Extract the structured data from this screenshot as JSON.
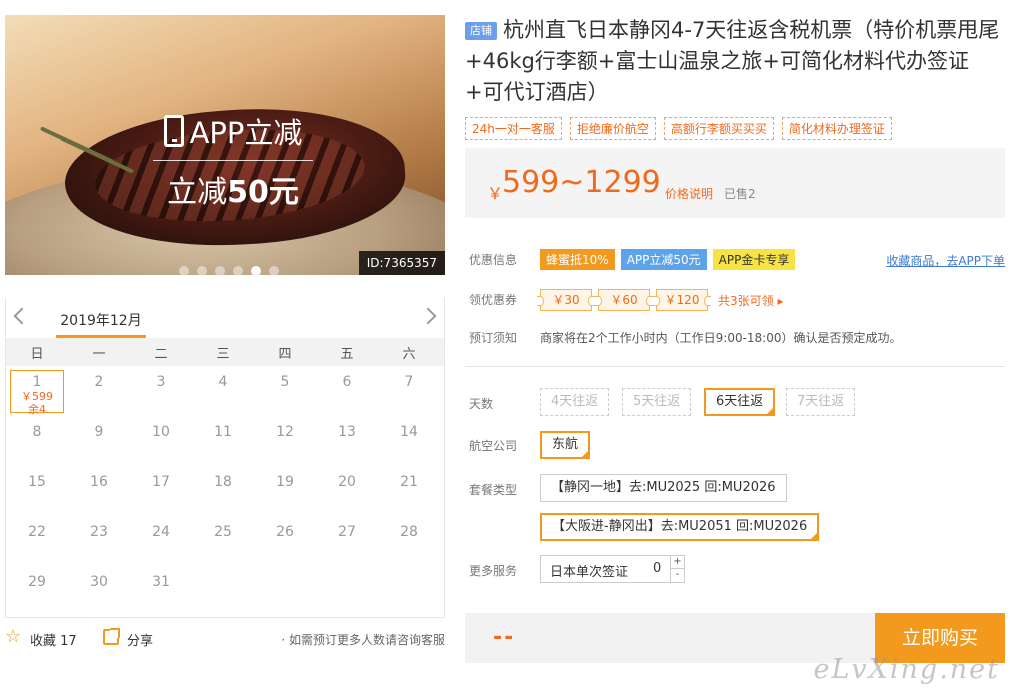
{
  "hero": {
    "promo_title": "APP立减",
    "promo_sub_prefix": "立减",
    "promo_sub_amount": "50元",
    "id_tag": "ID:7365357",
    "slide_count": 6,
    "active_slide": 5
  },
  "calendar": {
    "month": "2019年12月",
    "weekdays": [
      "日",
      "一",
      "二",
      "三",
      "四",
      "五",
      "六"
    ],
    "days": [
      {
        "day": "1",
        "price": "￥599",
        "stock": "余4",
        "selected": true
      },
      {
        "day": "2"
      },
      {
        "day": "3"
      },
      {
        "day": "4"
      },
      {
        "day": "5"
      },
      {
        "day": "6"
      },
      {
        "day": "7"
      },
      {
        "day": "8"
      },
      {
        "day": "9"
      },
      {
        "day": "10"
      },
      {
        "day": "11"
      },
      {
        "day": "12"
      },
      {
        "day": "13"
      },
      {
        "day": "14"
      },
      {
        "day": "15"
      },
      {
        "day": "16"
      },
      {
        "day": "17"
      },
      {
        "day": "18"
      },
      {
        "day": "19"
      },
      {
        "day": "20"
      },
      {
        "day": "21"
      },
      {
        "day": "22"
      },
      {
        "day": "23"
      },
      {
        "day": "24"
      },
      {
        "day": "25"
      },
      {
        "day": "26"
      },
      {
        "day": "27"
      },
      {
        "day": "28"
      },
      {
        "day": "29"
      },
      {
        "day": "30"
      },
      {
        "day": "31"
      }
    ]
  },
  "share_bar": {
    "favorite_label": "收藏",
    "favorite_count": "17",
    "share_label": "分享",
    "consult_text": "· 如需预订更多人数请咨询客服"
  },
  "product": {
    "shop_badge": "店铺",
    "title": "杭州直飞日本静冈4-7天往返含税机票（特价机票甩尾+46kg行李额+富士山温泉之旅+可简化材料代办签证+可代订酒店）",
    "tags": [
      "24h一对一客服",
      "拒绝廉价航空",
      "高额行李额买买买",
      "简化材料办理签证"
    ],
    "price_yen": "￥",
    "price": "599~1299",
    "price_note": "价格说明",
    "sold": "已售2"
  },
  "discounts": {
    "label": "优惠信息",
    "tags": [
      {
        "text": "蜂蜜抵10%",
        "style": "orange"
      },
      {
        "text": "APP立减50元",
        "style": "blue"
      },
      {
        "text": "APP金卡专享",
        "style": "yellow"
      }
    ],
    "app_link": "收藏商品，去APP下单"
  },
  "coupons": {
    "label": "领优惠券",
    "items": [
      "￥30",
      "￥60",
      "￥120"
    ],
    "more": "共3张可领 ▸"
  },
  "notice": {
    "label": "预订须知",
    "text": "商家将在2个工作小时内（工作日9:00-18:00）确认是否预定成功。"
  },
  "options": {
    "days_label": "天数",
    "days": [
      {
        "text": "4天往返",
        "state": "disabled"
      },
      {
        "text": "5天往返",
        "state": "disabled"
      },
      {
        "text": "6天往返",
        "state": "selected"
      },
      {
        "text": "7天往返",
        "state": "disabled"
      }
    ],
    "airline_label": "航空公司",
    "airline": "东航",
    "package_label": "套餐类型",
    "packages": [
      {
        "text": "【静冈一地】去:MU2025 回:MU2026",
        "state": "normal"
      },
      {
        "text": "【大阪进-静冈出】去:MU2051 回:MU2026",
        "state": "selected"
      }
    ],
    "service_label": "更多服务",
    "service_name": "日本单次签证",
    "service_qty": "0",
    "plus": "+",
    "minus": "-"
  },
  "buy": {
    "total": "--",
    "button": "立即购买"
  },
  "watermark": "eLvXing.net"
}
